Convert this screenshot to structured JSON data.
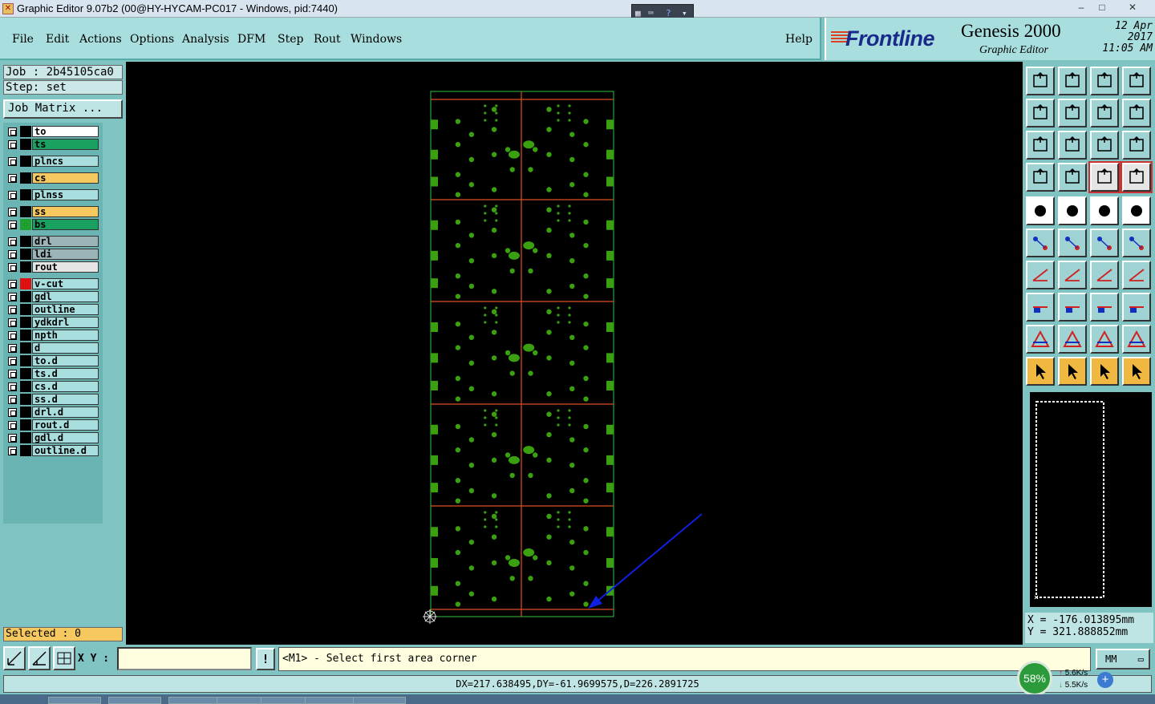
{
  "window": {
    "title": "Graphic Editor 9.07b2 (00@HY-HYCAM-PC017 - Windows, pid:7440)",
    "min": "–",
    "max": "□",
    "close": "✕"
  },
  "menu": {
    "file": "File",
    "edit": "Edit",
    "actions": "Actions",
    "options": "Options",
    "analysis": "Analysis",
    "dfm": "DFM",
    "step": "Step",
    "rout": "Rout",
    "windows": "Windows",
    "help": "Help"
  },
  "brand": {
    "logo": "Frontline",
    "product": "Genesis 2000",
    "subtitle": "Graphic Editor",
    "date": "12 Apr 2017",
    "time": "11:05 AM"
  },
  "job": {
    "job_label": "Job : 2b45105ca0",
    "step_label": "Step: set",
    "matrix_button": "Job Matrix ..."
  },
  "layers": [
    {
      "name": "to",
      "color": "#ffffff",
      "swatch": "#000000"
    },
    {
      "name": "ts",
      "color": "#1aa060",
      "swatch": "#000000"
    },
    {
      "name": "plncs",
      "color": "#a9dede",
      "swatch": "#000000"
    },
    {
      "name": "cs",
      "color": "#f5c860",
      "swatch": "#000000"
    },
    {
      "name": "plnss",
      "color": "#a9dede",
      "swatch": "#000000"
    },
    {
      "name": "ss",
      "color": "#f5c860",
      "swatch": "#000000"
    },
    {
      "name": "bs",
      "color": "#1aa060",
      "swatch": "#20a030"
    },
    {
      "name": "drl",
      "color": "#9ab4b8",
      "swatch": "#000000"
    },
    {
      "name": "ldi",
      "color": "#9ab4b8",
      "swatch": "#000000"
    },
    {
      "name": "rout",
      "color": "#e5e5e5",
      "swatch": "#000000"
    },
    {
      "name": "v-cut",
      "color": "#a9dede",
      "swatch": "#e01010"
    },
    {
      "name": "gdl",
      "color": "#a9dede",
      "swatch": "#000000"
    },
    {
      "name": "outline",
      "color": "#a9dede",
      "swatch": "#000000"
    },
    {
      "name": "ydkdrl",
      "color": "#a9dede",
      "swatch": "#000000"
    },
    {
      "name": "npth",
      "color": "#a9dede",
      "swatch": "#000000"
    },
    {
      "name": "d",
      "color": "#a9dede",
      "swatch": "#000000"
    },
    {
      "name": "to.d",
      "color": "#a9dede",
      "swatch": "#000000"
    },
    {
      "name": "ts.d",
      "color": "#a9dede",
      "swatch": "#000000"
    },
    {
      "name": "cs.d",
      "color": "#a9dede",
      "swatch": "#000000"
    },
    {
      "name": "ss.d",
      "color": "#a9dede",
      "swatch": "#000000"
    },
    {
      "name": "drl.d",
      "color": "#a9dede",
      "swatch": "#000000"
    },
    {
      "name": "rout.d",
      "color": "#a9dede",
      "swatch": "#000000"
    },
    {
      "name": "gdl.d",
      "color": "#a9dede",
      "swatch": "#000000"
    },
    {
      "name": "outline.d",
      "color": "#a9dede",
      "swatch": "#000000"
    }
  ],
  "selected": "Selected : 0",
  "coords": {
    "x": "X = -176.013895mm",
    "y": "Y = 321.888852mm"
  },
  "bottom": {
    "xy_label": "X Y :",
    "xy_value": "",
    "bang": "!",
    "prompt": "<M1> - Select first area corner",
    "unit": "MM",
    "status": "DX=217.638495,DY=-61.9699575,D=226.2891725"
  },
  "network": {
    "percent": "58%",
    "up": "5.6K/s",
    "down": "5.5K/s"
  },
  "colors": {
    "pad_green": "#3aa010",
    "route_orange": "#e05020",
    "profile": "#30c040",
    "arrow": "#1020e0"
  }
}
